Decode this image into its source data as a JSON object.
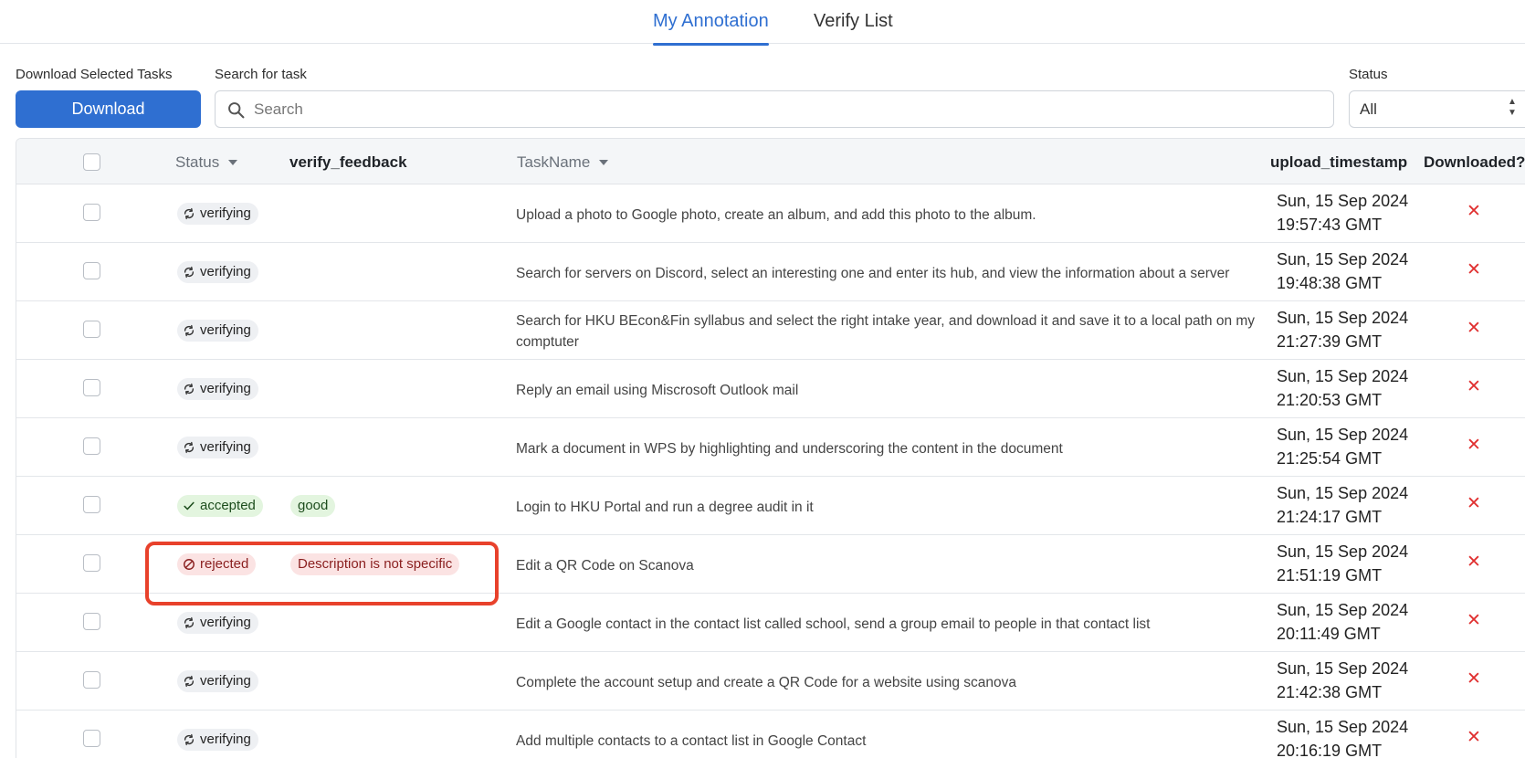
{
  "tabs": [
    {
      "label": "My Annotation",
      "active": true
    },
    {
      "label": "Verify List",
      "active": false
    }
  ],
  "toolbar": {
    "download_label_title": "Download Selected Tasks",
    "download_button": "Download",
    "search_label": "Search for task",
    "search_placeholder": "Search",
    "search_value": "",
    "status_label": "Status",
    "status_value": "All"
  },
  "table": {
    "headers": {
      "status": "Status",
      "verify_feedback": "verify_feedback",
      "task_name": "TaskName",
      "upload_timestamp": "upload_timestamp",
      "downloaded": "Downloaded?"
    },
    "rows": [
      {
        "status": "verifying",
        "feedback": "",
        "task": "Upload a photo to Google photo, create an album, and add this photo to the album.",
        "ts_date": "Sun, 15 Sep 2024",
        "ts_time": "19:57:43 GMT",
        "downloaded": "✕"
      },
      {
        "status": "verifying",
        "feedback": "",
        "task": "Search for servers on Discord, select an interesting one and enter its hub, and view the information about a server",
        "ts_date": "Sun, 15 Sep 2024",
        "ts_time": "19:48:38 GMT",
        "downloaded": "✕"
      },
      {
        "status": "verifying",
        "feedback": "",
        "task": "Search for HKU BEcon&Fin syllabus and select the right intake year, and download it and save it to a local path on my comptuter",
        "ts_date": "Sun, 15 Sep 2024",
        "ts_time": "21:27:39 GMT",
        "downloaded": "✕"
      },
      {
        "status": "verifying",
        "feedback": "",
        "task": "Reply an email using Miscrosoft Outlook mail",
        "ts_date": "Sun, 15 Sep 2024",
        "ts_time": "21:20:53 GMT",
        "downloaded": "✕"
      },
      {
        "status": "verifying",
        "feedback": "",
        "task": "Mark a document in WPS by highlighting and underscoring the content in the document",
        "ts_date": "Sun, 15 Sep 2024",
        "ts_time": "21:25:54 GMT",
        "downloaded": "✕"
      },
      {
        "status": "accepted",
        "feedback": "good",
        "task": "Login to HKU Portal and run a degree audit in it",
        "ts_date": "Sun, 15 Sep 2024",
        "ts_time": "21:24:17 GMT",
        "downloaded": "✕"
      },
      {
        "status": "rejected",
        "feedback": "Description is not specific",
        "task": "Edit a QR Code on Scanova",
        "ts_date": "Sun, 15 Sep 2024",
        "ts_time": "21:51:19 GMT",
        "downloaded": "✕"
      },
      {
        "status": "verifying",
        "feedback": "",
        "task": "Edit a Google contact in the contact list called school, send a group email to people in that contact list",
        "ts_date": "Sun, 15 Sep 2024",
        "ts_time": "20:11:49 GMT",
        "downloaded": "✕"
      },
      {
        "status": "verifying",
        "feedback": "",
        "task": "Complete the account setup and create a QR Code for a website using scanova",
        "ts_date": "Sun, 15 Sep 2024",
        "ts_time": "21:42:38 GMT",
        "downloaded": "✕"
      },
      {
        "status": "verifying",
        "feedback": "",
        "task": "Add multiple contacts to a contact list in Google Contact",
        "ts_date": "Sun, 15 Sep 2024",
        "ts_time": "20:16:19 GMT",
        "downloaded": "✕"
      }
    ]
  },
  "colors": {
    "accent": "#2f6fd1",
    "highlight": "#e8412b",
    "downloaded_no": "#e03030"
  },
  "icons": {
    "verifying": "refresh-icon",
    "accepted": "check-icon",
    "rejected": "ban-icon",
    "search": "search-icon"
  }
}
